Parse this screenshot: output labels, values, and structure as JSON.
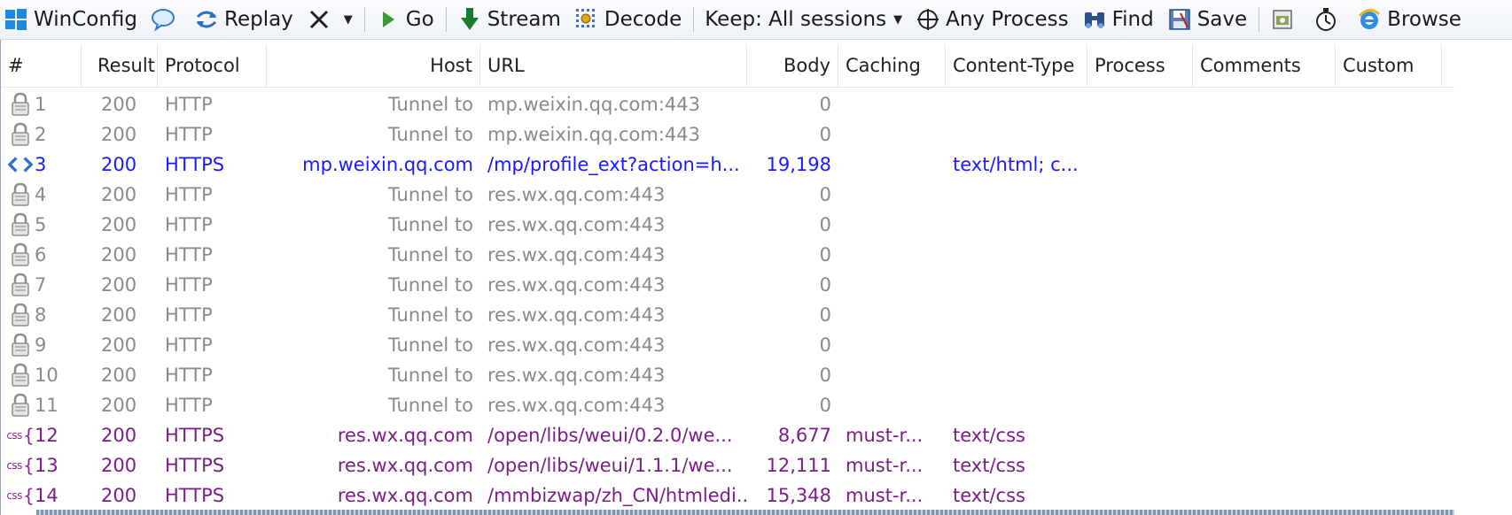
{
  "toolbar": {
    "winconfig": "WinConfig",
    "replay": "Replay",
    "go": "Go",
    "stream": "Stream",
    "decode": "Decode",
    "keep": "Keep: All sessions",
    "any_process": "Any Process",
    "find": "Find",
    "save": "Save",
    "browse": "Browse"
  },
  "columns": {
    "num": "#",
    "result": "Result",
    "protocol": "Protocol",
    "host": "Host",
    "url": "URL",
    "body": "Body",
    "caching": "Caching",
    "content_type": "Content-Type",
    "process": "Process",
    "comments": "Comments",
    "custom": "Custom"
  },
  "colors": {
    "tunnel": "#8a8a8a",
    "html": "#1a1aff",
    "css": "#7a1f86"
  },
  "sessions": [
    {
      "num": "1",
      "icon": "lock-icon",
      "result": "200",
      "protocol": "HTTP",
      "host": "Tunnel to",
      "url": "mp.weixin.qq.com:443",
      "body": "0",
      "caching": "",
      "content_type": "",
      "kind": "tunnel"
    },
    {
      "num": "2",
      "icon": "lock-icon",
      "result": "200",
      "protocol": "HTTP",
      "host": "Tunnel to",
      "url": "mp.weixin.qq.com:443",
      "body": "0",
      "caching": "",
      "content_type": "",
      "kind": "tunnel"
    },
    {
      "num": "3",
      "icon": "html-code-icon",
      "result": "200",
      "protocol": "HTTPS",
      "host": "mp.weixin.qq.com",
      "url": "/mp/profile_ext?action=h...",
      "body": "19,198",
      "caching": "",
      "content_type": "text/html; c...",
      "kind": "html"
    },
    {
      "num": "4",
      "icon": "lock-icon",
      "result": "200",
      "protocol": "HTTP",
      "host": "Tunnel to",
      "url": "res.wx.qq.com:443",
      "body": "0",
      "caching": "",
      "content_type": "",
      "kind": "tunnel"
    },
    {
      "num": "5",
      "icon": "lock-icon",
      "result": "200",
      "protocol": "HTTP",
      "host": "Tunnel to",
      "url": "res.wx.qq.com:443",
      "body": "0",
      "caching": "",
      "content_type": "",
      "kind": "tunnel"
    },
    {
      "num": "6",
      "icon": "lock-icon",
      "result": "200",
      "protocol": "HTTP",
      "host": "Tunnel to",
      "url": "res.wx.qq.com:443",
      "body": "0",
      "caching": "",
      "content_type": "",
      "kind": "tunnel"
    },
    {
      "num": "7",
      "icon": "lock-icon",
      "result": "200",
      "protocol": "HTTP",
      "host": "Tunnel to",
      "url": "res.wx.qq.com:443",
      "body": "0",
      "caching": "",
      "content_type": "",
      "kind": "tunnel"
    },
    {
      "num": "8",
      "icon": "lock-icon",
      "result": "200",
      "protocol": "HTTP",
      "host": "Tunnel to",
      "url": "res.wx.qq.com:443",
      "body": "0",
      "caching": "",
      "content_type": "",
      "kind": "tunnel"
    },
    {
      "num": "9",
      "icon": "lock-icon",
      "result": "200",
      "protocol": "HTTP",
      "host": "Tunnel to",
      "url": "res.wx.qq.com:443",
      "body": "0",
      "caching": "",
      "content_type": "",
      "kind": "tunnel"
    },
    {
      "num": "10",
      "icon": "lock-icon",
      "result": "200",
      "protocol": "HTTP",
      "host": "Tunnel to",
      "url": "res.wx.qq.com:443",
      "body": "0",
      "caching": "",
      "content_type": "",
      "kind": "tunnel"
    },
    {
      "num": "11",
      "icon": "lock-icon",
      "result": "200",
      "protocol": "HTTP",
      "host": "Tunnel to",
      "url": "res.wx.qq.com:443",
      "body": "0",
      "caching": "",
      "content_type": "",
      "kind": "tunnel"
    },
    {
      "num": "12",
      "icon": "css-icon",
      "result": "200",
      "protocol": "HTTPS",
      "host": "res.wx.qq.com",
      "url": "/open/libs/weui/0.2.0/we...",
      "body": "8,677",
      "caching": "must-r...",
      "content_type": "text/css",
      "kind": "css"
    },
    {
      "num": "13",
      "icon": "css-icon",
      "result": "200",
      "protocol": "HTTPS",
      "host": "res.wx.qq.com",
      "url": "/open/libs/weui/1.1.1/we...",
      "body": "12,111",
      "caching": "must-r...",
      "content_type": "text/css",
      "kind": "css"
    },
    {
      "num": "14",
      "icon": "css-icon",
      "result": "200",
      "protocol": "HTTPS",
      "host": "res.wx.qq.com",
      "url": "/mmbizwap/zh_CN/htmledi...",
      "body": "15,348",
      "caching": "must-r...",
      "content_type": "text/css",
      "kind": "css"
    }
  ]
}
